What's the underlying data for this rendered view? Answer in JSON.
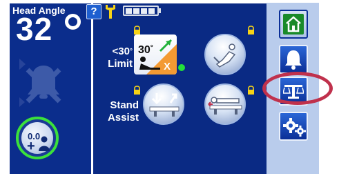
{
  "left_panel": {
    "head_angle_label": "Head Angle",
    "head_angle_value": "32",
    "scale_zero_label": "0.0"
  },
  "top_bar": {
    "help_label": "?",
    "battery_level": 1.0
  },
  "positions": {
    "limit_label_line1": "<30",
    "limit_label_line2": "Limit",
    "limit_tile_text": "30",
    "limit_tile_mark": "X",
    "stand_assist_line1": "Stand",
    "stand_assist_line2": "Assist"
  },
  "colors": {
    "panel": "#0a2a84",
    "nav_background": "#b9ccec",
    "accent_green": "#22e13a",
    "warning_orange": "#f39a33",
    "highlight": "#c0314c"
  }
}
